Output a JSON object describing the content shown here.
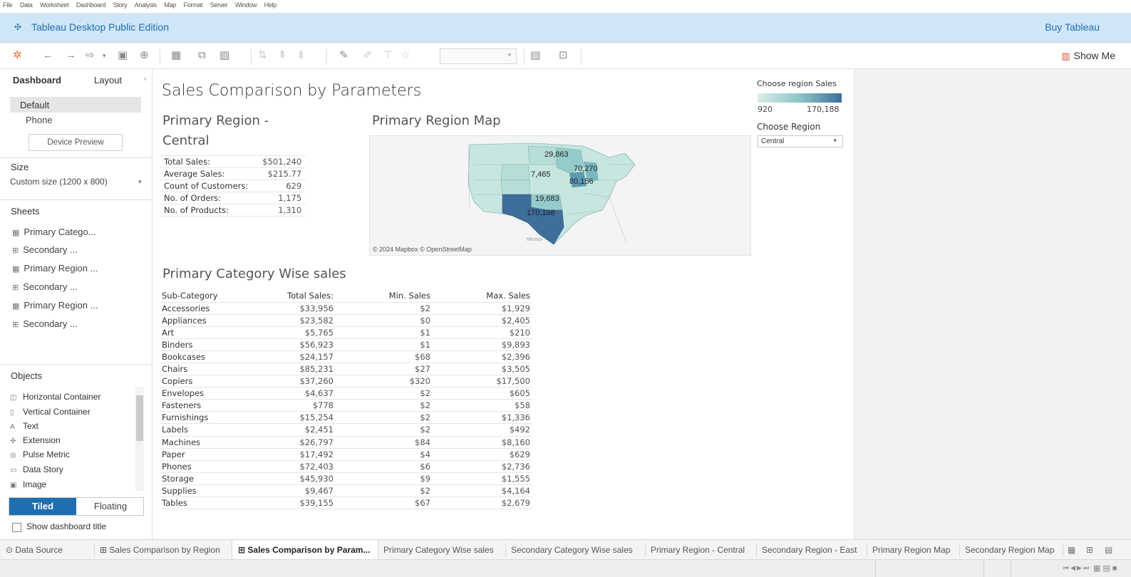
{
  "menu": [
    "File",
    "Data",
    "Worksheet",
    "Dashboard",
    "Story",
    "Analysis",
    "Map",
    "Format",
    "Server",
    "Window",
    "Help"
  ],
  "app": {
    "title": "Tableau Desktop Public Edition",
    "buy": "Buy Tableau",
    "show_me": "Show Me"
  },
  "left_pane": {
    "tabs": [
      "Dashboard",
      "Layout"
    ],
    "devices": [
      "Default",
      "Phone"
    ],
    "device_preview": "Device Preview",
    "size_title": "Size",
    "size_value": "Custom size (1200 x 800)",
    "sheets_title": "Sheets",
    "sheets": [
      "Primary Catego...",
      "Secondary ...",
      "Primary Region ...",
      "Secondary ...",
      "Primary Region ...",
      "Secondary ..."
    ],
    "objects_title": "Objects",
    "objects": [
      "Horizontal Container",
      "Vertical Container",
      "Text",
      "Extension",
      "Pulse Metric",
      "Data Story",
      "Image"
    ],
    "tiled": "Tiled",
    "floating": "Floating",
    "show_title": "Show dashboard title"
  },
  "dashboard": {
    "title": "Sales Comparison by Parameters",
    "region_title_1": "Primary Region -",
    "region_title_2": "Central",
    "kpis": [
      {
        "label": "Total Sales:",
        "value": "$501,240"
      },
      {
        "label": "Average Sales:",
        "value": "$215.77"
      },
      {
        "label": "Count of Customers:",
        "value": "629"
      },
      {
        "label": "No. of Orders:",
        "value": "1,175"
      },
      {
        "label": "No. of Products:",
        "value": "1,310"
      }
    ],
    "map_title": "Primary Region Map",
    "map_labels": [
      "29,863",
      "70,270",
      "7,465",
      "80,156",
      "19,683",
      "170,188"
    ],
    "map_credit": "© 2024 Mapbox © OpenStreetMap",
    "map_country": "Mexico",
    "category_title": "Primary Category Wise sales",
    "category_headers": [
      "Sub-Category",
      "Total Sales:",
      "Min. Sales",
      "Max. Sales"
    ],
    "category_rows": [
      [
        "Accessories",
        "$33,956",
        "$2",
        "$1,929"
      ],
      [
        "Appliances",
        "$23,582",
        "$0",
        "$2,405"
      ],
      [
        "Art",
        "$5,765",
        "$1",
        "$210"
      ],
      [
        "Binders",
        "$56,923",
        "$1",
        "$9,893"
      ],
      [
        "Bookcases",
        "$24,157",
        "$68",
        "$2,396"
      ],
      [
        "Chairs",
        "$85,231",
        "$27",
        "$3,505"
      ],
      [
        "Copiers",
        "$37,260",
        "$320",
        "$17,500"
      ],
      [
        "Envelopes",
        "$4,637",
        "$2",
        "$605"
      ],
      [
        "Fasteners",
        "$778",
        "$2",
        "$58"
      ],
      [
        "Furnishings",
        "$15,254",
        "$2",
        "$1,336"
      ],
      [
        "Labels",
        "$2,451",
        "$2",
        "$492"
      ],
      [
        "Machines",
        "$26,797",
        "$84",
        "$8,160"
      ],
      [
        "Paper",
        "$17,492",
        "$4",
        "$629"
      ],
      [
        "Phones",
        "$72,403",
        "$6",
        "$2,736"
      ],
      [
        "Storage",
        "$45,930",
        "$9",
        "$1,555"
      ],
      [
        "Supplies",
        "$9,467",
        "$2",
        "$4,164"
      ],
      [
        "Tables",
        "$39,155",
        "$67",
        "$2,679"
      ]
    ],
    "legend_title": "Choose region Sales",
    "legend_min": "920",
    "legend_max": "170,188",
    "legend_colors": [
      "#d8eeeb",
      "#8fc4c8",
      "#3f6e9a"
    ],
    "region_filter_title": "Choose Region",
    "region_filter_value": "Central"
  },
  "bottom_tabs": [
    "Data Source",
    "Sales Comparison by Region",
    "Sales Comparison by Param...",
    "Primary Category Wise sales",
    "Secondary Category Wise sales",
    "Primary Region - Central",
    "Secondary Region - East",
    "Primary Region Map",
    "Secondary Region Map"
  ],
  "colors": {
    "title_bar": "#cfe6f6",
    "accent": "#1f6fb0",
    "tiled_active": "#1f6fb0"
  }
}
